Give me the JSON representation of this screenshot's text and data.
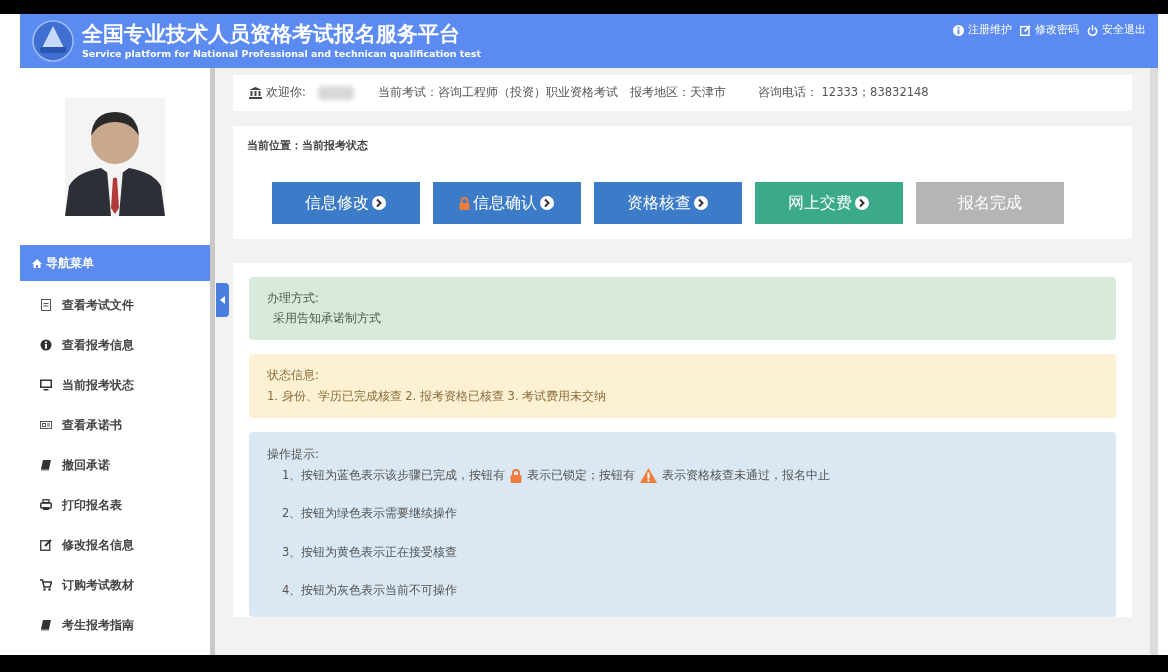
{
  "header": {
    "title": "全国专业技术人员资格考试报名服务平台",
    "subtitle": "Service platform for National Professional and technican qualification test",
    "links": [
      "注册维护",
      "修改密码",
      "安全退出"
    ]
  },
  "sidebar": {
    "menu_title": "导航菜单",
    "items": [
      {
        "label": "查看考试文件"
      },
      {
        "label": "查看报考信息"
      },
      {
        "label": "当前报考状态"
      },
      {
        "label": "查看承诺书"
      },
      {
        "label": "撤回承诺"
      },
      {
        "label": "打印报名表"
      },
      {
        "label": "修改报名信息"
      },
      {
        "label": "订购考试教材"
      },
      {
        "label": "考生报考指南"
      }
    ]
  },
  "info_bar": {
    "welcome": "欢迎你:",
    "exam": "当前考试：咨询工程师（投资）职业资格考试",
    "region": "报考地区：天津市",
    "phone": "咨询电话： 12333；83832148"
  },
  "breadcrumb": "当前位置：当前报考状态",
  "steps": [
    {
      "label": "信息修改",
      "completed": true,
      "disabled": false,
      "locked": false
    },
    {
      "label": "信息确认",
      "completed": true,
      "disabled": false,
      "locked": true
    },
    {
      "label": "资格核查",
      "completed": true,
      "disabled": false,
      "locked": false
    },
    {
      "label": "网上交费",
      "completed": false,
      "disabled": false,
      "locked": false
    },
    {
      "label": "报名完成",
      "completed": false,
      "disabled": true,
      "locked": false
    }
  ],
  "panels": [
    {
      "kind": "success",
      "title": "办理方式:",
      "lines": [
        "采用告知承诺制方式"
      ]
    },
    {
      "kind": "warning",
      "title": "状态信息:",
      "lines": [
        "1. 身份、学历已完成核查 2. 报考资格已核查 3. 考试费用未交纳"
      ]
    }
  ],
  "tips": {
    "title": "操作提示:",
    "items": [
      {
        "parts": [
          {
            "kind": "text",
            "text": "1、按钮为蓝色表示该步骤已完成，按钮有"
          },
          {
            "kind": "lock"
          },
          {
            "kind": "text",
            "text": "表示已锁定；按钮有"
          },
          {
            "kind": "warning"
          },
          {
            "kind": "text",
            "text": "表示资格核查未通过，报名中止"
          }
        ]
      },
      {
        "parts": [
          {
            "kind": "text",
            "text": "2、按钮为绿色表示需要继续操作"
          }
        ]
      },
      {
        "parts": [
          {
            "kind": "text",
            "text": "3、按钮为黄色表示正在接受核查"
          }
        ]
      },
      {
        "parts": [
          {
            "kind": "text",
            "text": "4、按钮为灰色表示当前不可操作"
          }
        ]
      }
    ]
  }
}
